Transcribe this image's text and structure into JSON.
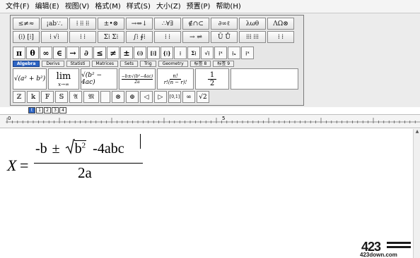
{
  "menubar": {
    "items": [
      "文件(F)",
      "编辑(E)",
      "视图(V)",
      "格式(M)",
      "样式(S)",
      "大小(Z)",
      "预置(P)",
      "帮助(H)"
    ]
  },
  "toolbar": {
    "row1": [
      "≤≠≈",
      "¡ab∵.",
      "⁞ ⁞⁞ ⁞⁞",
      "±•⊗",
      "→⇔↓",
      "∴∀∃",
      "∉∩⊂",
      "∂∞ℓ",
      "λωθ",
      "ΛΩ⊗"
    ],
    "row2": [
      "(⁞) [⁞]",
      "⁞ √⁞",
      "⁞ ⁞",
      "Σ⁞ Σ⁞",
      "∫⁞ ∮⁞",
      "⁞ ⁞",
      "→ ⇌",
      "Ū Ů",
      "⁞⁞⁞ ⁞⁞⁞",
      "⁞ ⁞"
    ],
    "symbols": [
      "π",
      "θ",
      "∞",
      "∈",
      "→",
      "∂",
      "≤",
      "≠",
      "±",
      "(⁞)",
      "[⁞]",
      "{⁞}",
      "⁞",
      "Σ⁞",
      "√⁞",
      "⁞ˣ",
      "⁞ₓ",
      "⁞ˣ"
    ],
    "tabs": [
      "Algebra",
      "Derivs",
      "Statisti",
      "Matrices",
      "Sets",
      "Trig",
      "Geometry",
      "标签 8",
      "标签 9"
    ],
    "templates": {
      "t1": "√(a² + b²)",
      "t2_top": "lim",
      "t2_bot": "x→∞",
      "t3": "√(b² − 4ac)",
      "t4_top": "−b±√(b²−4ac)",
      "t4_bot": "2a",
      "t5_top": "n!",
      "t5_bot": "r!(n − r)!",
      "t6_top": "1",
      "t6_bot": "2"
    },
    "row5": [
      "ℤ",
      "𝕜",
      "𝔽",
      "𝕊",
      "𝔄",
      "𝔐",
      "",
      "⊗",
      "⊕",
      "◁",
      "▷",
      "[0,1]",
      "∞",
      "√2"
    ]
  },
  "minibar": [
    "t",
    "1",
    "2",
    "3",
    "4"
  ],
  "ruler": {
    "marks": [
      "0",
      "5"
    ]
  },
  "equation": {
    "lhs": "X",
    "equals": "=",
    "num_left": "-b",
    "pm": "±",
    "sqrt_content": "b",
    "sqrt_exp": "2",
    "num_right": "-4abc",
    "denominator": "2a"
  },
  "watermark": {
    "logo": "423",
    "text": "423down.com"
  }
}
